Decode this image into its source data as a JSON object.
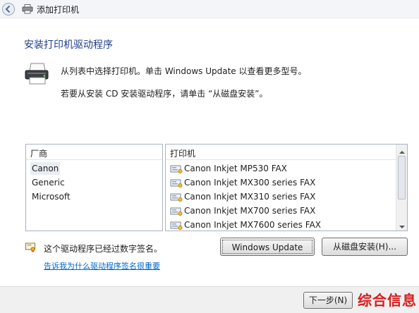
{
  "window": {
    "title": "添加打印机"
  },
  "heading": "安装打印机驱动程序",
  "instructions": {
    "line1": "从列表中选择打印机。单击 Windows Update 以查看更多型号。",
    "line2": "若要从安装 CD 安装驱动程序，请单击 “从磁盘安装”。"
  },
  "manufacturers": {
    "header": "厂商",
    "items": [
      "Canon",
      "Generic",
      "Microsoft"
    ],
    "selected": "Canon"
  },
  "printers": {
    "header": "打印机",
    "items": [
      "Canon Inkjet MP530 FAX",
      "Canon Inkjet MX300 series FAX",
      "Canon Inkjet MX310 series FAX",
      "Canon Inkjet MX700 series FAX",
      "Canon Inkjet MX7600 series FAX"
    ]
  },
  "signature": {
    "status": "这个驱动程序已经过数字签名。",
    "link": "告诉我为什么驱动程序签名很重要"
  },
  "buttons": {
    "windows_update": "Windows Update",
    "have_disk": "从磁盘安装(H)...",
    "next": "下一步(N)"
  },
  "watermark": "综合信息",
  "colors": {
    "heading": "#1e3f8c",
    "link": "#0066cc",
    "watermark": "#d71d1d"
  }
}
